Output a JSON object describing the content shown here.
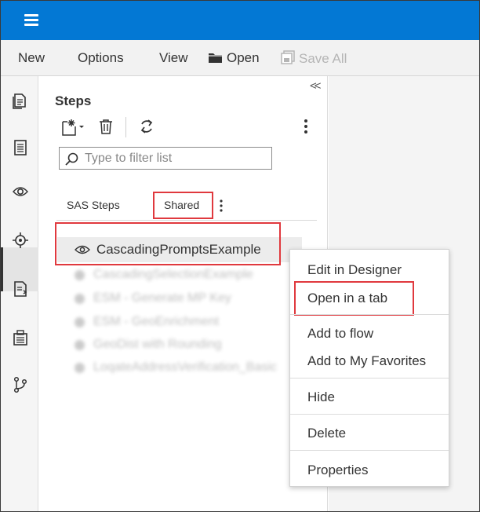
{
  "menubar": {
    "new": "New",
    "options": "Options",
    "view": "View",
    "open": "Open",
    "save_all": "Save All"
  },
  "panel": {
    "collapse_glyph": "<<",
    "title": "Steps",
    "filter_placeholder": "Type to filter list",
    "tabs": [
      {
        "label": "SAS Steps",
        "selected": false
      },
      {
        "label": "Shared",
        "selected": true
      }
    ],
    "selected_item": "CascadingPromptsExample",
    "blurred_items": [
      "CascadingSelectionExample",
      "ESM - Generate MP Key",
      "ESM - GeoEnrichment",
      "GeoDist with Rounding",
      "LoqateAddressVerification_Basic"
    ]
  },
  "context_menu": {
    "items": [
      {
        "label": "Edit in Designer"
      },
      {
        "label": "Open in a tab",
        "highlighted": true
      },
      {
        "label": "Add to flow"
      },
      {
        "label": "Add to My Favorites"
      },
      {
        "label": "Hide"
      },
      {
        "label": "Delete"
      },
      {
        "label": "Properties"
      }
    ]
  },
  "colors": {
    "topbar": "#0378d4",
    "highlight_box": "#e0393e",
    "menubar": "#f2f2f2"
  },
  "icons": {
    "menu": "hamburger-icon",
    "open": "folder-icon",
    "save_all": "save-all-icon",
    "new_step": "new-step-icon",
    "delete": "trash-icon",
    "refresh": "refresh-icon",
    "more": "kebab-icon",
    "filter": "search-icon",
    "step": "custom-step-icon"
  }
}
